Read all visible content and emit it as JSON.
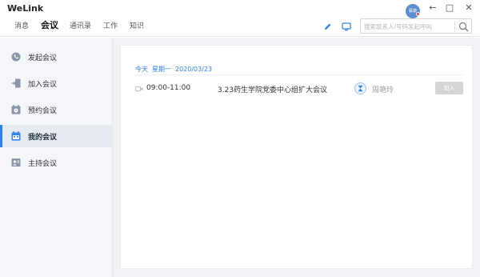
{
  "app": {
    "title": "WeLink"
  },
  "nav": {
    "tabs": [
      "消息",
      "会议",
      "通讯录",
      "工作",
      "知识"
    ],
    "active": "会议"
  },
  "user": {
    "avatar_text": "蔡康"
  },
  "window_controls": {
    "back": "←",
    "minimize": "—",
    "maximize": "□",
    "close": "✕"
  },
  "search": {
    "placeholder": "搜索联系人/号码发起呼叫",
    "value": ""
  },
  "sidebar": {
    "items": [
      {
        "label": "发起会议",
        "icon": "phone-icon"
      },
      {
        "label": "加入会议",
        "icon": "join-door-icon"
      },
      {
        "label": "预约会议",
        "icon": "calendar-clock-icon"
      },
      {
        "label": "我的会议",
        "icon": "calendar-icon",
        "active": true
      },
      {
        "label": "主持会议",
        "icon": "host-icon"
      }
    ]
  },
  "date_header": {
    "today": "今天",
    "weekday": "星期一",
    "date": "2020/03/23"
  },
  "meeting": {
    "time": "09:00-11:00",
    "title": "3.23药生学院党委中心组扩大会议",
    "host": "周艳玲",
    "join_label": "加入"
  },
  "colors": {
    "accent": "#2f80ed",
    "sidebar_bg": "#f4f6f9",
    "main_bg": "#f0f2f5",
    "join_disabled": "#d4d4d4"
  }
}
